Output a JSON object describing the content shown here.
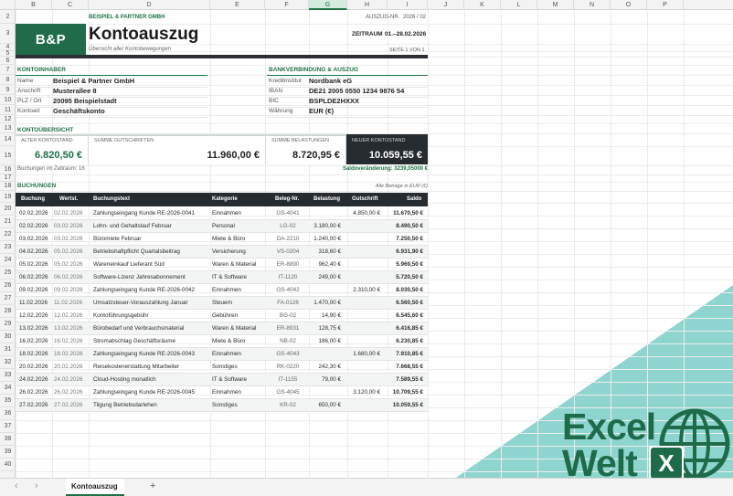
{
  "columns": [
    "B",
    "C",
    "D",
    "E",
    "F",
    "G",
    "H",
    "I",
    "J",
    "K",
    "L",
    "M",
    "N",
    "O",
    "P"
  ],
  "selected_column": "G",
  "rows": [
    "2",
    "3",
    "4",
    "5",
    "6",
    "7",
    "8",
    "9",
    "10",
    "11",
    "12",
    "13",
    "14",
    "15",
    "16",
    "17",
    "18",
    "19",
    "20",
    "21",
    "22",
    "23",
    "24",
    "25",
    "26",
    "27",
    "28",
    "29",
    "30",
    "31",
    "32",
    "33",
    "34",
    "35",
    "36",
    "37",
    "38",
    "39",
    "40"
  ],
  "header": {
    "company_tag": "BEISPIEL & PARTNER GMBH",
    "logo": "B&P",
    "title": "Kontoauszug",
    "subtitle": "Übersicht aller Kontobewegungen",
    "statement_no_label": "AUSZUG-NR.",
    "statement_no": "2026 / 02",
    "period_label": "ZEITRAUM",
    "period": "01.–28.02.2026",
    "page": "SEITE 1 VON 1"
  },
  "holder": {
    "section": "KONTOINHABER",
    "fields": [
      {
        "label": "Name",
        "value": "Beispiel & Partner GmbH"
      },
      {
        "label": "Anschrift",
        "value": "Musterallee 8"
      },
      {
        "label": "PLZ / Ort",
        "value": "20095 Beispielstadt"
      },
      {
        "label": "Kontoart",
        "value": "Geschäftskonto"
      }
    ]
  },
  "bank": {
    "section": "BANKVERBINDUNG & AUSZUG",
    "fields": [
      {
        "label": "Kreditinstitut",
        "value": "Nordbank eG"
      },
      {
        "label": "IBAN",
        "value": "DE21 2005 0550 1234 9876 54"
      },
      {
        "label": "BIC",
        "value": "BSPLDE2HXXX"
      },
      {
        "label": "Währung",
        "value": "EUR (€)"
      }
    ]
  },
  "overview": {
    "section": "KONTOÜBERSICHT",
    "old_label": "ALTER KONTOSTAND",
    "old_value": "6.820,50 €",
    "credits_label": "SUMME GUTSCHRIFTEN",
    "credits_value": "11.960,00 €",
    "debits_label": "SUMME BELASTUNGEN",
    "debits_value": "8.720,95 €",
    "new_label": "NEUER KONTOSTAND",
    "new_value": "10.059,55 €",
    "count_text": "Buchungen im Zeitraum:  16",
    "change_text": "Saldoveränderung: 3239,05000 €"
  },
  "bookings": {
    "section": "BUCHUNGEN",
    "note": "Alle Beträge in EUR (€)",
    "headers": [
      "Buchung",
      "Wertst.",
      "Buchungstext",
      "Kategorie",
      "Beleg-Nr.",
      "Belastung",
      "Gutschrift",
      "Saldo"
    ],
    "rows": [
      [
        "02.02.2026",
        "02.02.2026",
        "Zahlungseingang Kunde RE-2026-0041",
        "Einnahmen",
        "GS-4041",
        "",
        "4.850,00 €",
        "11.670,50 €"
      ],
      [
        "02.02.2026",
        "03.02.2026",
        "Lohn- und Gehaltslauf Februar",
        "Personal",
        "LG-02",
        "3.180,00 €",
        "",
        "8.490,50 €"
      ],
      [
        "03.02.2026",
        "03.02.2026",
        "Büromiete Februar",
        "Miete & Büro",
        "DA-2210",
        "1.240,00 €",
        "",
        "7.250,50 €"
      ],
      [
        "04.02.2026",
        "05.02.2026",
        "Betriebshaftpflicht Quartalsbeitrag",
        "Versicherung",
        "VS-0204",
        "318,60 €",
        "",
        "6.931,90 €"
      ],
      [
        "05.02.2026",
        "05.02.2026",
        "Wareneinkauf Lieferant Süd",
        "Waren & Material",
        "ER-8890",
        "962,40 €",
        "",
        "5.969,50 €"
      ],
      [
        "06.02.2026",
        "06.02.2026",
        "Software-Lizenz Jahresabonnement",
        "IT & Software",
        "IT-1120",
        "249,00 €",
        "",
        "5.720,50 €"
      ],
      [
        "09.02.2026",
        "09.02.2026",
        "Zahlungseingang Kunde RE-2026-0042",
        "Einnahmen",
        "GS-4042",
        "",
        "2.310,00 €",
        "8.030,50 €"
      ],
      [
        "11.02.2026",
        "11.02.2026",
        "Umsatzsteuer-Vorauszahlung Januar",
        "Steuern",
        "FA-0126",
        "1.470,00 €",
        "",
        "6.560,50 €"
      ],
      [
        "12.02.2026",
        "12.02.2026",
        "Kontoführungsgebühr",
        "Gebühren",
        "BG-02",
        "14,90 €",
        "",
        "6.545,60 €"
      ],
      [
        "13.02.2026",
        "13.02.2026",
        "Bürobedarf und Verbrauchsmaterial",
        "Waren & Material",
        "ER-8931",
        "128,75 €",
        "",
        "6.416,85 €"
      ],
      [
        "16.02.2026",
        "16.02.2026",
        "Stromabschlag Geschäftsräume",
        "Miete & Büro",
        "NB-02",
        "186,00 €",
        "",
        "6.230,85 €"
      ],
      [
        "18.02.2026",
        "18.02.2026",
        "Zahlungseingang Kunde RE-2026-0043",
        "Einnahmen",
        "GS-4043",
        "",
        "1.680,00 €",
        "7.910,85 €"
      ],
      [
        "20.02.2026",
        "20.02.2026",
        "Reisekostenerstattung Mitarbeiter",
        "Sonstiges",
        "RK-0220",
        "242,30 €",
        "",
        "7.668,55 €"
      ],
      [
        "24.02.2026",
        "24.02.2026",
        "Cloud-Hosting monatlich",
        "IT & Software",
        "IT-1155",
        "79,00 €",
        "",
        "7.589,55 €"
      ],
      [
        "26.02.2026",
        "26.02.2026",
        "Zahlungseingang Kunde RE-2026-0045",
        "Einnahmen",
        "GS-4045",
        "",
        "3.120,00 €",
        "10.709,55 €"
      ],
      [
        "27.02.2026",
        "27.02.2026",
        "Tilgung Betriebsdarlehen",
        "Sonstiges",
        "KR-02",
        "650,00 €",
        "",
        "10.059,55 €"
      ]
    ]
  },
  "tabbar": {
    "prev": "‹",
    "next": "›",
    "sheet": "Kontoauszug",
    "add": "+"
  },
  "brand": {
    "line1": "Excel",
    "line2": "Welt",
    "badge": "X"
  },
  "colors": {
    "accent": "#1e7145",
    "dark": "#262b2f",
    "teal": "#8fd5cf",
    "brand_green": "#1e6b4a"
  }
}
